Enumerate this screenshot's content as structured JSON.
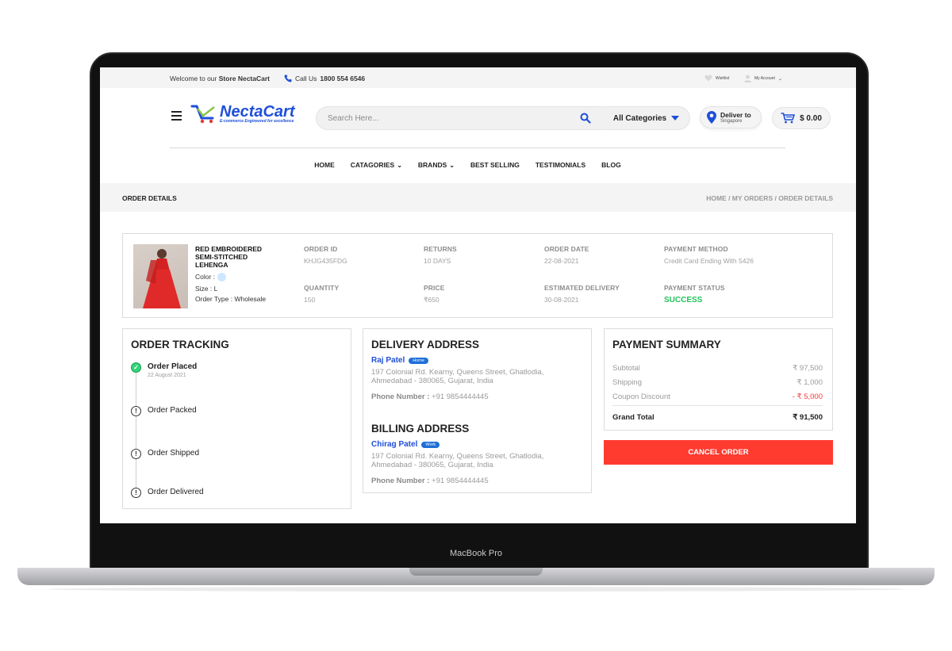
{
  "device": {
    "label": "MacBook Pro"
  },
  "topbar": {
    "welcome_prefix": "Welcome to our",
    "welcome_store": "Store NectaCart",
    "call_prefix": "Call Us",
    "phone": "1800 554 6546",
    "wishlist": "Wishlist",
    "account": "My Account"
  },
  "header": {
    "brand": "NectaCart",
    "tagline": "E-commerce Engineered for excellence",
    "search_placeholder": "Search Here...",
    "category": "All Categories",
    "deliver_title": "Deliver to",
    "deliver_location": "Singapore",
    "cart_total": "$ 0.00"
  },
  "nav": {
    "items": [
      "HOME",
      "CATAGORIES",
      "BRANDS",
      "BEST SELLING",
      "TESTIMONIALS",
      "BLOG"
    ]
  },
  "page": {
    "title": "ORDER DETAILS",
    "breadcrumb": "HOME / MY ORDERS / ORDER DETAILS"
  },
  "product": {
    "name": "RED EMBROIDERED SEMI-STITCHED LEHENGA",
    "color_label": "Color :",
    "size": "Size : L",
    "order_type": "Order Type : Wholesale",
    "fields": [
      {
        "label": "ORDER ID",
        "value": "KHJG435FDG"
      },
      {
        "label": "RETURNS",
        "value": "10 DAYS"
      },
      {
        "label": "ORDER DATE",
        "value": "22-08-2021"
      },
      {
        "label": "PAYMENT METHOD",
        "value": "Credit Card Ending With 5426"
      },
      {
        "label": "QUANTITY",
        "value": "150"
      },
      {
        "label": "PRICE",
        "value": "₹650"
      },
      {
        "label": "ESTIMATED DELIVERY",
        "value": "30-08-2021"
      },
      {
        "label": "PAYMENT STATUS",
        "value": "SUCCESS"
      }
    ]
  },
  "tracking": {
    "title": "ORDER TRACKING",
    "steps": [
      {
        "label": "Order Placed",
        "date": "22 August 2021"
      },
      {
        "label": "Order Packed"
      },
      {
        "label": "Order Shipped"
      },
      {
        "label": "Order Delivered"
      }
    ]
  },
  "delivery": {
    "title": "DELIVERY ADDRESS",
    "name": "Raj Patel",
    "badge": "Home",
    "address": "197 Colonial Rd. Kearny, Queens Street, Ghatlodia, Ahmedabad - 380065, Gujarat, India",
    "phone_label": "Phone Number :",
    "phone": "+91 9854444445"
  },
  "billing": {
    "title": "BILLING ADDRESS",
    "name": "Chirag Patel",
    "badge": "Work",
    "address": "197 Colonial Rd. Kearny, Queens Street, Ghatlodia, Ahmedabad - 380065, Gujarat, India",
    "phone_label": "Phone Number :",
    "phone": "+91 9854444445"
  },
  "payment": {
    "title": "PAYMENT SUMMARY",
    "rows": [
      {
        "label": "Subtotal",
        "value": "₹ 97,500"
      },
      {
        "label": "Shipping",
        "value": "₹ 1,000"
      },
      {
        "label": "Coupon Discount",
        "value": "- ₹ 5,000"
      }
    ],
    "total_label": "Grand Total",
    "total_value": "₹ 91,500",
    "cancel_label": "CANCEL ORDER"
  },
  "colors": {
    "brand": "#1e4fd8",
    "success": "#21c45a",
    "danger": "#ff3b30"
  }
}
